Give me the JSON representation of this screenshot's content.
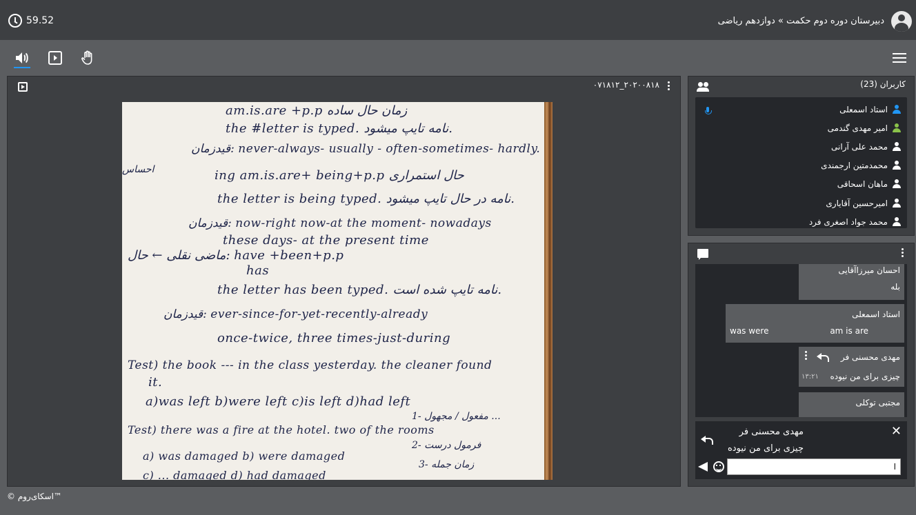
{
  "header": {
    "timer": "59.52",
    "breadcrumb": "دبیرستان دوره دوم حکمت » دوازدهم ریاضی"
  },
  "toolbar": {
    "icons": [
      "speaker-icon",
      "presentation-icon",
      "raise-hand-icon",
      "menu-icon"
    ]
  },
  "presentation": {
    "title": "۰۷۱۸۱۲_۲۰۲۰۰۸۱۸",
    "notes": [
      "am.is.are +p.p  زمان حال ساده",
      "the #letter is typed.  نامه تایپ میشود.",
      "قیدزمان: never-always- usually - often-sometimes- hardly.",
      "احساس",
      "ing  am.is.are+ being+p.p  حال استمراری",
      "the letter is being typed.  نامه در حال تایپ میشود.",
      "قیدزمان: now-right now-at the moment- nowadays",
      "these days- at the present time",
      "ماضی نقلی  ← حال: have +been+p.p",
      "has",
      "the letter has been typed.  نامه تایپ شده است.",
      "قیدزمان: ever-since-for-yet-recently-already",
      "once-twice, three times-just-during",
      "Test) the book --- in the class yesterday. the cleaner found",
      "it.",
      "a)was left     b)were left     c)is left     d)had left",
      "Test) there was a fire at the hotel. two of the rooms",
      "1- مفعول / مجهول ...",
      "2- فرمول درست",
      "3- زمان جمله",
      "a) was damaged     b) were damaged",
      "c) ... damaged     d) had damaged"
    ]
  },
  "users": {
    "title": "کاربران (23)",
    "list": [
      {
        "name": "استاد اسمعلی",
        "color": "#2196f3"
      },
      {
        "name": "امیر مهدی گندمی",
        "color": "#8bc34a"
      },
      {
        "name": "محمد علی آرانی",
        "color": "#ffffff"
      },
      {
        "name": "محمدمتین ارجمندی",
        "color": "#ffffff"
      },
      {
        "name": "ماهان اسحاقی",
        "color": "#ffffff"
      },
      {
        "name": "امیرحسین آقایاری",
        "color": "#ffffff"
      },
      {
        "name": "محمد جواد اصغری فرد",
        "color": "#ffffff"
      }
    ]
  },
  "chat": {
    "messages": [
      {
        "name": "احسان میرزاآقایی",
        "body": "بله"
      },
      {
        "name": "استاد اسمعلی",
        "body_right": "am is are",
        "body_left": "was were"
      },
      {
        "name": "مهدی محسنی فر",
        "body": "چیزی برای من نیوده",
        "time": "۱۳:۲۱"
      },
      {
        "name": "مجتبی توکلی"
      }
    ],
    "reply": {
      "name": "مهدی محسنی فر",
      "text": "چیزی برای من نیوده"
    },
    "input_value": "ا"
  },
  "footer": {
    "brand": "© اسکای‌روم™"
  },
  "colors": {
    "accent": "#2196f3",
    "bg": "#5b5d60",
    "panel": "#3d3f42",
    "dark": "#25272b"
  }
}
